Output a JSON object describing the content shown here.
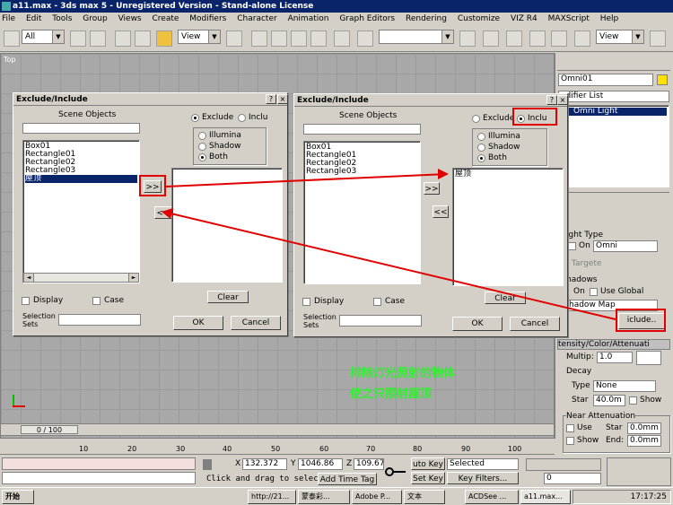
{
  "window": {
    "title": "a11.max - 3ds max 5 - Unregistered Version - Stand-alone License"
  },
  "menu": [
    "File",
    "Edit",
    "Tools",
    "Group",
    "Views",
    "Create",
    "Modifiers",
    "Character",
    "Animation",
    "Graph Editors",
    "Rendering",
    "Customize",
    "VIZ R4",
    "MAXScript",
    "Help"
  ],
  "toolbar": {
    "selection_filter": "All",
    "ref_coord": "View",
    "ref_coord2": "View"
  },
  "viewport": {
    "label": "Top"
  },
  "dialog_left": {
    "title": "Exclude/Include",
    "scene_objects_label": "Scene Objects",
    "items": [
      "Box01",
      "Rectangle01",
      "Rectangle02",
      "Rectangle03",
      "屋顶"
    ],
    "selected": "屋顶",
    "exclude_label": "Exclude",
    "include_label": "Inclu",
    "illum_label": "Illumina",
    "shadow_label": "Shadow",
    "both_label": "Both",
    "add_button": ">>",
    "remove_button": "<<",
    "clear_button": "Clear",
    "display_label": "Display",
    "case_label": "Case",
    "sel_sets_label": "Selection Sets",
    "ok_button": "OK",
    "cancel_button": "Cancel"
  },
  "dialog_right": {
    "title": "Exclude/Include",
    "scene_objects_label": "Scene Objects",
    "items": [
      "Box01",
      "Rectangle01",
      "Rectangle02",
      "Rectangle03"
    ],
    "right_items": [
      "屋顶"
    ],
    "exclude_label": "Exclude",
    "include_label": "Inclu",
    "illum_label": "Illumina",
    "shadow_label": "Shadow",
    "both_label": "Both",
    "add_button": ">>",
    "remove_button": "<<",
    "clear_button": "Clear",
    "display_label": "Display",
    "case_label": "Case",
    "sel_sets_label": "Selection Sets",
    "ok_button": "OK",
    "cancel_button": "Cancel"
  },
  "cmdpanel": {
    "object_name": "Omni01",
    "modifier_list": "odifier List",
    "stack_item": "Omni Light",
    "light_type_label": "ight Type",
    "on_label": "On",
    "light_type": "Omni",
    "targeted": "Targete",
    "shadows_label": "hadows",
    "shadows_on": "On",
    "use_global": "Use Global",
    "shadow_type": "hadow Map",
    "exclude_button": "iclude..",
    "intensity_header": "tensity/Color/Attenuati",
    "multiplier_label": "Multip:",
    "multiplier": "1.0",
    "decay_label": "Decay",
    "decay_type_label": "Type",
    "decay_type": "None",
    "start_label": "Star",
    "start_val": "40.0m",
    "show_label": "Show",
    "near_atten_label": "Near Attenuation",
    "use_label": "Use",
    "show2_label": "Show",
    "star2": "Star",
    "end_label": "End:",
    "near_start": "0.0mm",
    "near_end": "0.0mm"
  },
  "annotation": {
    "line1": "排除灯光照射的物体",
    "line2": "使之只照射屋顶"
  },
  "timeline": {
    "frame": "0 / 100",
    "ticks": [
      "10",
      "20",
      "30",
      "40",
      "50",
      "60",
      "70",
      "80",
      "90",
      "100"
    ]
  },
  "status": {
    "x_label": "X",
    "x": "132.372",
    "y_label": "Y",
    "y": "1046.86",
    "z_label": "Z",
    "z": "109.67",
    "prompt": "Click and drag to select",
    "add_time_tag": "Add Time Tag",
    "auto_key": "uto Key",
    "set_key": "Set Key",
    "key_mode": "Selected",
    "key_filters": "Key Filters...",
    "frame_field": "0"
  },
  "taskbar": {
    "start": "开始",
    "tasks": [
      "http://21...",
      "蒙泰彩...",
      "Adobe P...",
      "文本",
      "ACDSee ...",
      "a11.max..."
    ],
    "clock": "17:17:25"
  }
}
